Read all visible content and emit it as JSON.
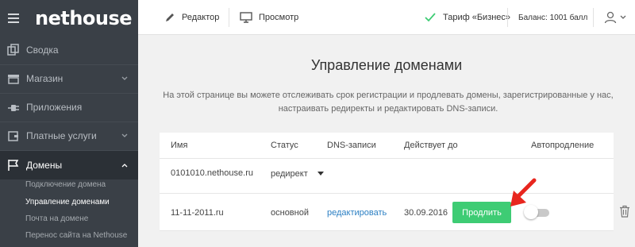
{
  "app": {
    "logo_text": "nethouse"
  },
  "sidebar": {
    "items": [
      {
        "label": "Сводка",
        "icon": "copy-icon"
      },
      {
        "label": "Магазин",
        "icon": "store-icon"
      },
      {
        "label": "Приложения",
        "icon": "plug-icon"
      },
      {
        "label": "Платные услуги",
        "icon": "wallet-icon"
      },
      {
        "label": "Домены",
        "icon": "flag-icon"
      }
    ],
    "domain_subitems": [
      {
        "label": "Подключение домена"
      },
      {
        "label": "Управление доменами"
      },
      {
        "label": "Почта на домене"
      },
      {
        "label": "Перенос сайта на Nethouse"
      }
    ]
  },
  "topbar": {
    "editor_label": "Редактор",
    "preview_label": "Просмотр",
    "tariff_label": "Тариф «Бизнес»",
    "balance_label": "Баланс: 1001 балл"
  },
  "main": {
    "title": "Управление доменами",
    "description": "На этой странице вы можете отслеживать срок регистрации и продлевать домены, зарегистрированные у нас, настраивать редиректы и редактировать DNS-записи."
  },
  "table": {
    "headers": {
      "name": "Имя",
      "status": "Статус",
      "dns": "DNS-записи",
      "valid_until": "Действует до",
      "autorenew": "Автопродление"
    },
    "rows": [
      {
        "name": "0101010.nethouse.ru",
        "status": "редирект"
      },
      {
        "name": "11-11-2011.ru",
        "status": "основной",
        "dns": "редактировать",
        "valid_until": "30.09.2016",
        "action": "Продлить",
        "autorenew": false
      }
    ]
  },
  "colors": {
    "sidebar_bg": "#3a4047",
    "accent_green": "#3ecc74",
    "link_blue": "#2b7fc3",
    "annotation_red": "#e8261e"
  }
}
